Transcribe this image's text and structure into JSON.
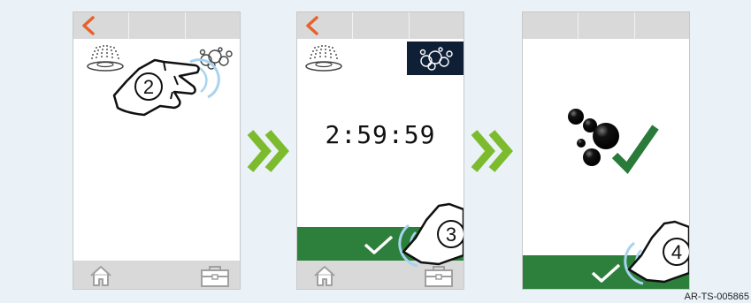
{
  "screen1": {
    "step_number": "2"
  },
  "screen2": {
    "timer": "2:59:59",
    "step_number": "3"
  },
  "screen3": {
    "step_number": "4"
  },
  "colors": {
    "accent_orange": "#e8612c",
    "confirm_green": "#2d7f3c",
    "chevron_green": "#7dbb2e",
    "check_green": "#2a7a3a",
    "bar_gray": "#d9d9d9",
    "steam_bg": "#0f1f36"
  },
  "icons": {
    "back": "chevron-left-icon",
    "home": "home-icon",
    "tools": "toolbox-icon",
    "shower": "shower-icon",
    "steam": "steam-bubbles-icon",
    "confirm": "checkmark-icon",
    "next": "double-chevron-right-icon",
    "done": "bubbles-check-icon"
  },
  "footer": {
    "document_id": "AR-TS-005865"
  }
}
